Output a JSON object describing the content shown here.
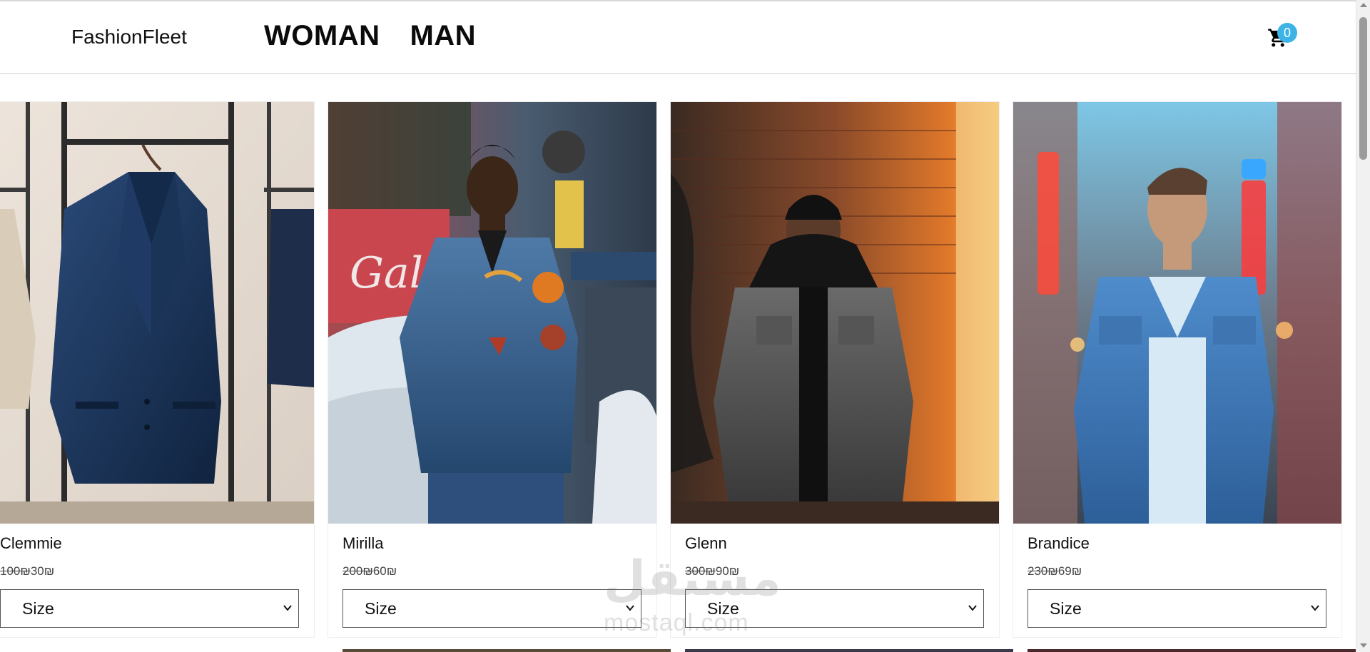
{
  "header": {
    "brand": "FashionFleet",
    "nav": [
      "WOMAN",
      "MAN"
    ],
    "cart_count": "0"
  },
  "products": [
    {
      "name": "Clemmie",
      "old_price": "100₪",
      "new_price": "30₪",
      "size_label": "Size",
      "image": "navy-blazer-on-rack"
    },
    {
      "name": "Mirilla",
      "old_price": "200₪",
      "new_price": "60₪",
      "size_label": "Size",
      "image": "man-denim-jacket-with-patches"
    },
    {
      "name": "Glenn",
      "old_price": "300₪",
      "new_price": "90₪",
      "size_label": "Size",
      "image": "man-grey-denim-jacket-brick-wall"
    },
    {
      "name": "Brandice",
      "old_price": "230₪",
      "new_price": "69₪",
      "size_label": "Size",
      "image": "man-blue-denim-jacket-neon-street"
    }
  ],
  "watermark": {
    "arabic": "مستقل",
    "latin": "mostaql.com"
  },
  "icons": {
    "cart": "cart-icon",
    "select": "chevron-down-icon"
  },
  "colors": {
    "badge": "#3db3e6",
    "text": "#111111"
  }
}
